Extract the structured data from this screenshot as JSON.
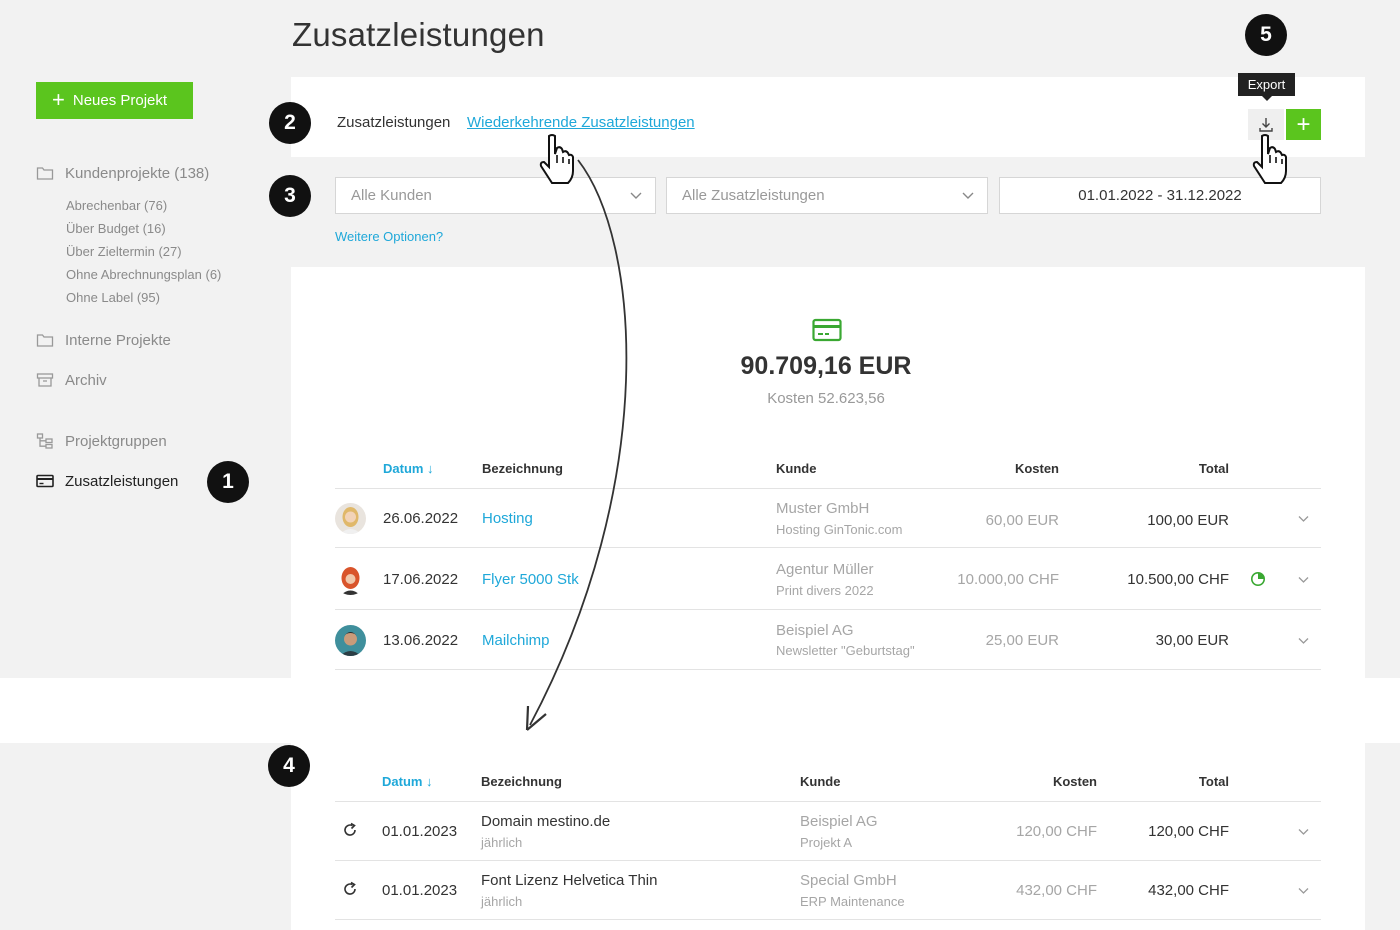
{
  "page_title": "Zusatzleistungen",
  "sidebar": {
    "new_project_label": "Neues Projekt",
    "kundenprojekte": "Kundenprojekte (138)",
    "sub_items": [
      "Abrechenbar (76)",
      "Über Budget (16)",
      "Über Zieltermin (27)",
      "Ohne Abrechnungsplan (6)",
      "Ohne Label (95)"
    ],
    "interne_projekte": "Interne Projekte",
    "archiv": "Archiv",
    "projektgruppen": "Projektgruppen",
    "zusatzleistungen": "Zusatzleistungen"
  },
  "badges": [
    "1",
    "2",
    "3",
    "4",
    "5"
  ],
  "tabs": {
    "active": "Zusatzleistungen",
    "link": "Wiederkehrende Zusatzleistungen"
  },
  "toolbar": {
    "export_tooltip": "Export",
    "add_label": "+"
  },
  "filters": {
    "customer": "Alle Kunden",
    "service": "Alle Zusatzleistungen",
    "date_range": "01.01.2022 - 31.12.2022",
    "more_options": "Weitere Optionen?"
  },
  "summary": {
    "total": "90.709,16 EUR",
    "costs": "Kosten 52.623,56"
  },
  "table1": {
    "headers": {
      "datum": "Datum ↓",
      "bezeichnung": "Bezeichnung",
      "kunde": "Kunde",
      "kosten": "Kosten",
      "total": "Total"
    },
    "rows": [
      {
        "date": "26.06.2022",
        "name": "Hosting",
        "customer": "Muster GmbH",
        "project": "Hosting GinTonic.com",
        "costs": "60,00 EUR",
        "total": "100,00 EUR"
      },
      {
        "date": "17.06.2022",
        "name": "Flyer 5000 Stk",
        "customer": "Agentur Müller",
        "project": "Print divers 2022",
        "costs": "10.000,00 CHF",
        "total": "10.500,00 CHF"
      },
      {
        "date": "13.06.2022",
        "name": "Mailchimp",
        "customer": "Beispiel AG",
        "project": "Newsletter \"Geburtstag\"",
        "costs": "25,00 EUR",
        "total": "30,00 EUR"
      }
    ]
  },
  "table2": {
    "headers": {
      "datum": "Datum ↓",
      "bezeichnung": "Bezeichnung",
      "kunde": "Kunde",
      "kosten": "Kosten",
      "total": "Total"
    },
    "rows": [
      {
        "date": "01.01.2023",
        "name": "Domain mestino.de",
        "interval": "jährlich",
        "customer": "Beispiel AG",
        "project": "Projekt A",
        "costs": "120,00 CHF",
        "total": "120,00 CHF"
      },
      {
        "date": "01.01.2023",
        "name": "Font Lizenz Helvetica Thin",
        "interval": "jährlich",
        "customer": "Special GmbH",
        "project": "ERP Maintenance",
        "costs": "432,00 CHF",
        "total": "432,00 CHF"
      }
    ]
  },
  "colors": {
    "accent_green": "#5bc51e",
    "link_blue": "#1fa8d9",
    "badge": "#111111"
  }
}
